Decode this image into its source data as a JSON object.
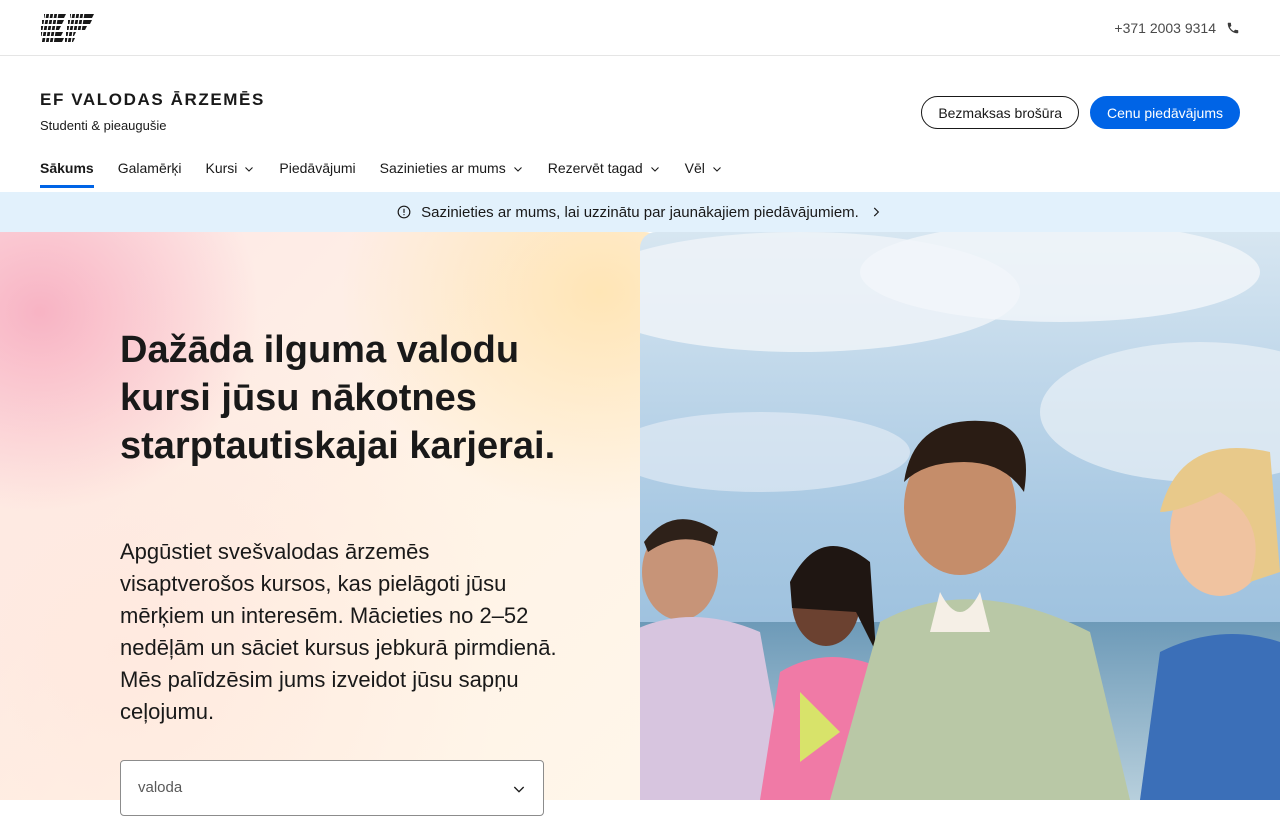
{
  "topbar": {
    "logo_label": "EF",
    "phone": "+371 2003 9314",
    "phone_icon": "phone-icon"
  },
  "brand": {
    "title": "EF VALODAS ĀRZEMĒS",
    "subtitle": "Studenti & pieaugušie"
  },
  "actions": {
    "brochure": "Bezmaksas brošūra",
    "quote": "Cenu piedāvājums"
  },
  "nav": {
    "items": [
      {
        "label": "Sākums",
        "has_dropdown": false,
        "active": true
      },
      {
        "label": "Galamērķi",
        "has_dropdown": false,
        "active": false
      },
      {
        "label": "Kursi",
        "has_dropdown": true,
        "active": false
      },
      {
        "label": "Piedāvājumi",
        "has_dropdown": false,
        "active": false
      },
      {
        "label": "Sazinieties ar mums",
        "has_dropdown": true,
        "active": false
      },
      {
        "label": "Rezervēt tagad",
        "has_dropdown": true,
        "active": false
      },
      {
        "label": "Vēl",
        "has_dropdown": true,
        "active": false
      }
    ]
  },
  "notice": {
    "text": "Sazinieties ar mums, lai uzzinātu par jaunākajiem piedāvājumiem.",
    "icon": "info-icon"
  },
  "hero": {
    "title": "Dažāda ilguma valodu kursi jūsu nākotnes starptautiskajai karjerai.",
    "text": "Apgūstiet svešvalodas ārzemēs visaptverošos kursos, kas pielāgoti jūsu mērķiem un interesēm. Mācieties no 2–52 nedēļām un sāciet kursus jebkurā pirmdienā. Mēs palīdzēsim jums izveidot jūsu sapņu ceļojumu.",
    "select_placeholder": "valoda"
  },
  "colors": {
    "accent": "#0064e6",
    "notice_bg": "#e2f1fc",
    "text": "#191919"
  }
}
